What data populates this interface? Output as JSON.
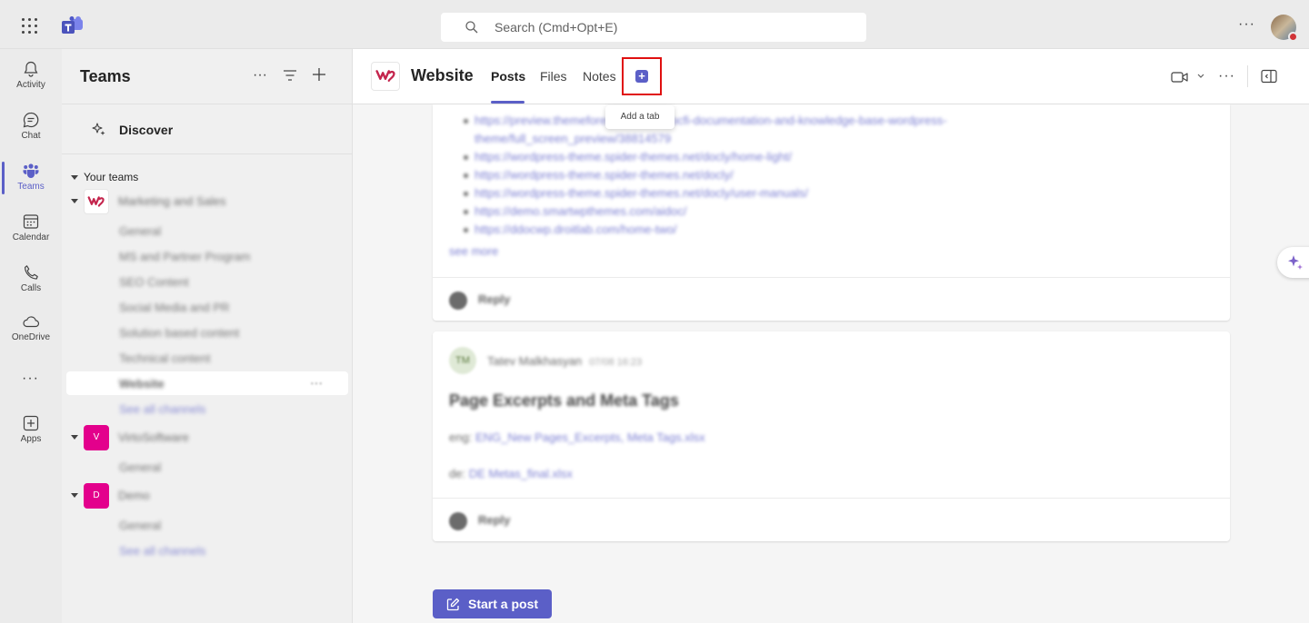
{
  "topbar": {
    "search_placeholder": "Search (Cmd+Opt+E)",
    "more": "···"
  },
  "rail": {
    "items": [
      {
        "label": "Activity",
        "icon": "bell-icon"
      },
      {
        "label": "Chat",
        "icon": "chat-icon"
      },
      {
        "label": "Teams",
        "icon": "teams-icon",
        "active": true
      },
      {
        "label": "Calendar",
        "icon": "calendar-icon"
      },
      {
        "label": "Calls",
        "icon": "phone-icon"
      },
      {
        "label": "OneDrive",
        "icon": "cloud-icon"
      },
      {
        "label": "Apps",
        "icon": "apps-plus-icon"
      }
    ],
    "more": "···"
  },
  "panel": {
    "title": "Teams",
    "more": "···",
    "discover": "Discover",
    "your_teams": "Your teams",
    "teams": [
      {
        "name": "Marketing and Sales",
        "channels": [
          "General",
          "MS and Partner Program",
          "SEO Content",
          "Social Media and PR",
          "Solution based content",
          "Technical content",
          "Website"
        ],
        "selected_channel": "Website",
        "see_all": "See all channels"
      },
      {
        "name": "VirtoSoftware",
        "initial": "V",
        "channels": [
          "General"
        ]
      },
      {
        "name": "Demo",
        "initial": "D",
        "channels": [
          "General"
        ],
        "see_all": "See all channels"
      }
    ],
    "colors": {
      "team_avatar": "#e3008c",
      "accent": "#5b5fc7"
    }
  },
  "header": {
    "channel_title": "Website",
    "tabs": [
      {
        "label": "Posts",
        "active": true
      },
      {
        "label": "Files"
      },
      {
        "label": "Notes"
      }
    ],
    "add_tab_symbol": "+",
    "tooltip": "Add a tab",
    "more": "···"
  },
  "posts": {
    "post1": {
      "links": [
        "https://preview.themeforest.net/item/docfi-documentation-and-knowledge-base-wordpress-",
        "theme/full_screen_preview/38814579",
        "https://wordpress-theme.spider-themes.net/docly/home-light/",
        "https://wordpress-theme.spider-themes.net/docly/",
        "https://wordpress-theme.spider-themes.net/docly/user-manuals/",
        "https://demo.smartwpthemes.com/aidoc/",
        "https://ddocwp.droitlab.com/home-two/"
      ],
      "see_more": "see more",
      "reply": "Reply"
    },
    "post2": {
      "author_initials": "TM",
      "author": "Tatev Malkhasyan",
      "time": "07/08 16:23",
      "title": "Page Excerpts and Meta Tags",
      "line1_prefix": "eng:",
      "line1_link": "ENG_New Pages_Excerpts, Meta Tags.xlsx",
      "line2_prefix": "de:",
      "line2_link": "DE Metas_final.xlsx",
      "reply": "Reply"
    },
    "start_post": "Start a post"
  }
}
